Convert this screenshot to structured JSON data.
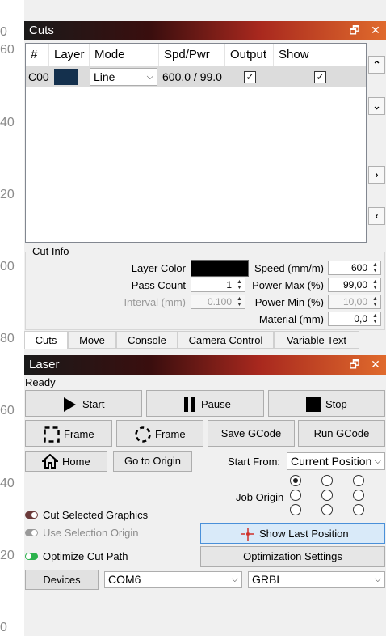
{
  "ruler": {
    "labels": [
      "0",
      "60",
      "40",
      "20",
      "00",
      "80",
      "60",
      "40",
      "20",
      "0"
    ]
  },
  "cuts_panel": {
    "title": "Cuts",
    "columns": [
      "#",
      "Layer",
      "Mode",
      "Spd/Pwr",
      "Output",
      "Show"
    ],
    "rows": [
      {
        "id": "C00",
        "layer_color": "#14304d",
        "mode": "Line",
        "spd_pwr": "600.0 / 99.0",
        "output": "✓",
        "show": "✓"
      }
    ],
    "side_buttons": {
      "up": "⌃",
      "down": "⌄",
      "right": "›",
      "left": "‹"
    }
  },
  "cut_info": {
    "legend": "Cut Info",
    "layer_color_label": "Layer Color",
    "layer_color": "#000000",
    "pass_count_label": "Pass Count",
    "pass_count": "1",
    "interval_label": "Interval (mm)",
    "interval": "0.100",
    "speed_label": "Speed (mm/m)",
    "speed": "600",
    "power_max_label": "Power Max (%)",
    "power_max": "99,00",
    "power_min_label": "Power Min (%)",
    "power_min": "10,00",
    "material_label": "Material (mm)",
    "material": "0,0"
  },
  "tabs": [
    "Cuts",
    "Move",
    "Console",
    "Camera Control",
    "Variable Text"
  ],
  "laser_panel": {
    "title": "Laser",
    "status": "Ready",
    "start": "Start",
    "pause": "Pause",
    "stop": "Stop",
    "frame1": "Frame",
    "frame2": "Frame",
    "save_gcode": "Save GCode",
    "run_gcode": "Run GCode",
    "home": "Home",
    "go_to_origin": "Go to Origin",
    "start_from_label": "Start From:",
    "start_from_value": "Current Position",
    "job_origin_label": "Job Origin",
    "cut_selected": "Cut Selected Graphics",
    "use_selection_origin": "Use Selection Origin",
    "optimize_cut_path": "Optimize Cut Path",
    "show_last_position": "Show Last Position",
    "optimization_settings": "Optimization Settings",
    "devices": "Devices",
    "port": "COM6",
    "firmware": "GRBL"
  },
  "title_icons": {
    "float": "🗗",
    "close": "✕"
  },
  "colors": {
    "title_gradient_end": "#e06a2c",
    "highlight_button": "#d9eaf9",
    "toggle_on": "#2bb24c",
    "toggle_off": "#6b3a3a"
  }
}
